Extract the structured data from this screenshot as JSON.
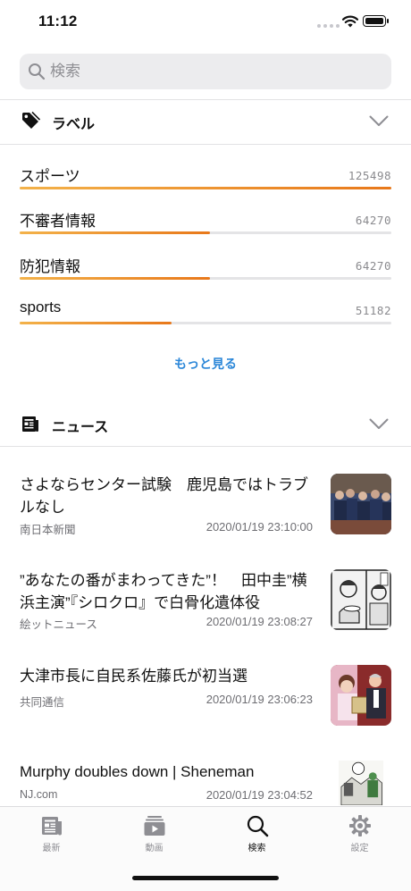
{
  "status_bar": {
    "time": "11:12"
  },
  "search": {
    "placeholder": "検索"
  },
  "labels_section": {
    "title": "ラベル",
    "items": [
      {
        "name": "スポーツ",
        "count": "125498",
        "ratio": 1.0
      },
      {
        "name": "不審者情報",
        "count": "64270",
        "ratio": 0.512
      },
      {
        "name": "防犯情報",
        "count": "64270",
        "ratio": 0.512
      },
      {
        "name": "sports",
        "count": "51182",
        "ratio": 0.408
      }
    ],
    "more_label": "もっと見る"
  },
  "news_section": {
    "title": "ニュース",
    "items": [
      {
        "title": "さよならセンター試験　鹿児島ではトラブルなし",
        "source": "南日本新聞",
        "date": "2020/01/19 23:10:00",
        "thumb": "students-photo"
      },
      {
        "title": "”あなたの番がまわってきた”！　田中圭”横浜主演”『シロクロ』で白骨化遺体役",
        "source": "絵ットニュース",
        "date": "2020/01/19 23:08:27",
        "thumb": "manga-panel"
      },
      {
        "title": "大津市長に自民系佐藤氏が初当選",
        "source": "共同通信",
        "date": "2020/01/19 23:06:23",
        "thumb": "election-photo"
      },
      {
        "title": "Murphy doubles down | Sheneman",
        "source": "NJ.com",
        "date": "2020/01/19 23:04:52",
        "thumb": "cartoon"
      }
    ]
  },
  "tab_bar": {
    "tabs": [
      {
        "label": "最新",
        "icon": "newspaper-icon",
        "active": false
      },
      {
        "label": "動画",
        "icon": "video-icon",
        "active": false
      },
      {
        "label": "検索",
        "icon": "search-icon",
        "active": true
      },
      {
        "label": "設定",
        "icon": "gear-icon",
        "active": false
      }
    ]
  },
  "colors": {
    "bar_start": "#f3b24a",
    "bar_end": "#e8781a",
    "link": "#2a86d8"
  }
}
